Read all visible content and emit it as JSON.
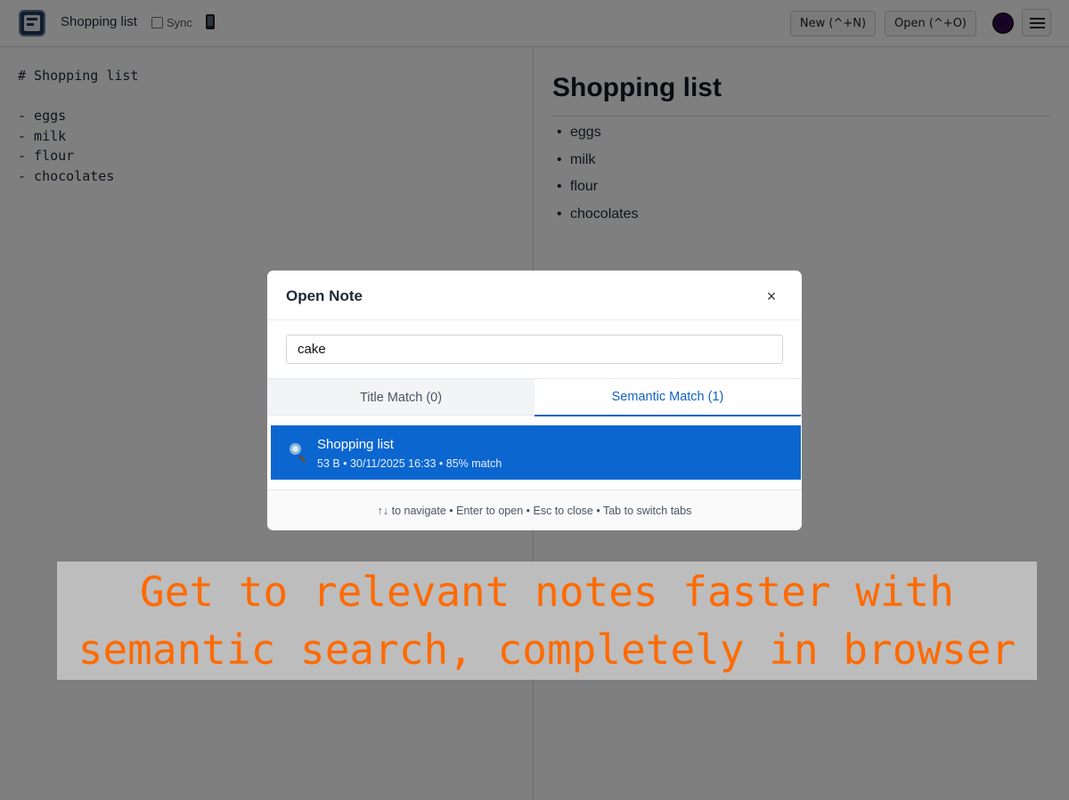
{
  "header": {
    "title": "Shopping list",
    "sync_label": "Sync",
    "new_button": "New (^+N)",
    "open_button": "Open (^+O)"
  },
  "editor": {
    "content": "# Shopping list\n\n- eggs\n- milk\n- flour\n- chocolates"
  },
  "preview": {
    "heading": "Shopping list",
    "items": [
      "eggs",
      "milk",
      "flour",
      "chocolates"
    ]
  },
  "modal": {
    "title": "Open Note",
    "close_symbol": "×",
    "search_value": "cake",
    "tabs": {
      "title_match": "Title Match (0)",
      "semantic_match": "Semantic Match (1)"
    },
    "results": [
      {
        "title": "Shopping list",
        "meta": "53 B • 30/11/2025 16:33 • 85% match"
      }
    ],
    "footer": "↑↓ to navigate • Enter to open • Esc to close • Tab to switch tabs"
  },
  "banner": {
    "line1": "Get to relevant notes faster with",
    "line2": "semantic search, completely in browser"
  },
  "colors": {
    "accent": "#0b66d0",
    "banner_text": "#ff6a00",
    "banner_bg": "#bdbdbd"
  },
  "icons": {
    "logo": "app-logo-icon",
    "sync": "checkbox-icon",
    "mobile": "phone-icon",
    "theme": "theme-toggle-icon",
    "menu": "hamburger-menu-icon",
    "close": "close-icon",
    "result": "magnifier-icon"
  }
}
